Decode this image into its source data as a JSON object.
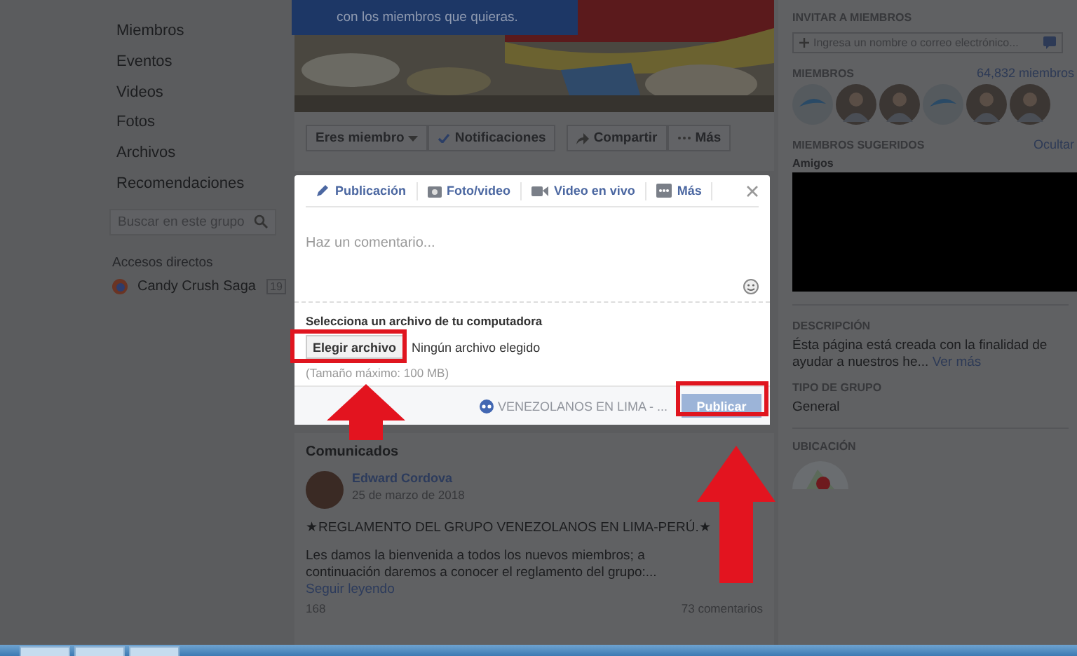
{
  "sidebar": {
    "nav_items": [
      "Miembros",
      "Eventos",
      "Videos",
      "Fotos",
      "Archivos",
      "Recomendaciones"
    ],
    "search": {
      "placeholder": "Buscar en este grupo"
    },
    "shortcuts_title": "Accesos directos",
    "shortcuts": [
      {
        "label": "Candy Crush Saga",
        "count": "19"
      }
    ]
  },
  "cover": {
    "tooltip": "con los miembros que quieras."
  },
  "action_groups": [
    [
      {
        "label": "Eres miembro",
        "kind": "dropdown"
      },
      {
        "label": "Notificaciones",
        "kind": "check"
      }
    ],
    [
      {
        "label": "Compartir",
        "kind": "share"
      },
      {
        "label": "Más",
        "kind": "more"
      }
    ]
  ],
  "composer": {
    "tabs": [
      {
        "label": "Publicación",
        "kind": "pencil"
      },
      {
        "label": "Foto/video",
        "kind": "camera"
      },
      {
        "label": "Video en vivo",
        "kind": "video"
      },
      {
        "label": "Más",
        "kind": "more"
      }
    ],
    "placeholder": "Haz un comentario...",
    "file_title": "Selecciona un archivo de tu computadora",
    "file_button": "Elegir archivo",
    "file_status": "Ningún archivo elegido",
    "file_hint": "(Tamaño máximo: 100 MB)",
    "audience": "VENEZOLANOS EN LIMA - ...",
    "submit": {
      "label": "Publicar",
      "disabled": true
    }
  },
  "announcements": {
    "title": "Comunicados",
    "post": {
      "author": "Edward Cordova",
      "date": "25 de marzo de 2018",
      "headline": "★REGLAMENTO DEL GRUPO VENEZOLANOS EN LIMA-PERÚ.★",
      "body": "Les damos la bienvenida a todos los nuevos miembros; a continuación daremos a conocer el reglamento del grupo:...",
      "more": "Seguir leyendo",
      "reactions": "168",
      "comments": "73 comentarios"
    }
  },
  "right": {
    "invite": {
      "title": "INVITAR A MIEMBROS",
      "placeholder": "Ingresa un nombre o correo electrónico..."
    },
    "members": {
      "title": "MIEMBROS",
      "count": "64,832 miembros",
      "avatars": [
        {
          "kind": "logo"
        },
        {
          "kind": "person"
        },
        {
          "kind": "person"
        },
        {
          "kind": "logo"
        },
        {
          "kind": "person"
        },
        {
          "kind": "person"
        }
      ]
    },
    "suggested": {
      "title": "MIEMBROS SUGERIDOS",
      "hide": "Ocultar",
      "subtitle": "Amigos"
    },
    "description": {
      "title": "DESCRIPCIÓN",
      "text": "Ésta página está creada con la finalidad de ayudar a nuestros he...",
      "more": "Ver más"
    },
    "group_type": {
      "title": "TIPO DE GRUPO",
      "value": "General"
    },
    "location": {
      "title": "UBICACIÓN"
    }
  }
}
